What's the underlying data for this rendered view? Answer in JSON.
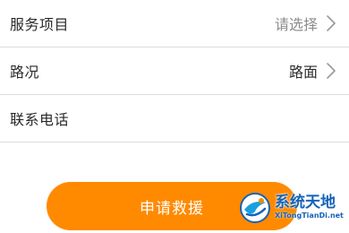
{
  "form": {
    "rows": [
      {
        "label": "服务项目",
        "value": "请选择",
        "value_is_placeholder": true,
        "has_chevron": true
      },
      {
        "label": "路况",
        "value": "路面",
        "value_is_placeholder": false,
        "has_chevron": true
      },
      {
        "label": "联系电话",
        "value": "",
        "value_is_placeholder": false,
        "has_chevron": false
      }
    ]
  },
  "submit": {
    "label": "申请救援",
    "color": "#ff8a00"
  },
  "watermark": {
    "title": "系统天地",
    "domain": "XiTongTianDi.net"
  },
  "colors": {
    "accent": "#ff8a00",
    "text": "#2a2a2a",
    "placeholder": "#8c8c8c",
    "divider": "#dcdcdc",
    "watermark": "#1463b8"
  },
  "icons": {
    "row_chevron": "chevron-right-icon",
    "watermark_logo": "xitongtiandi-logo-icon"
  }
}
